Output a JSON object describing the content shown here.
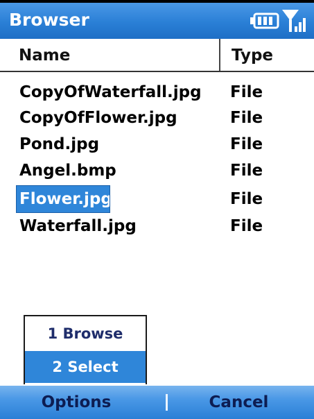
{
  "title_bar": {
    "title": "Browser",
    "battery_icon": "battery-full-icon",
    "signal_icon": "signal-strength-icon"
  },
  "list_header": {
    "name_label": "Name",
    "type_label": "Type"
  },
  "files": [
    {
      "name": "CopyOfWaterfall.jpg",
      "type": "File",
      "selected": false
    },
    {
      "name": "CopyOfFlower.jpg",
      "type": "File",
      "selected": false
    },
    {
      "name": "Pond.jpg",
      "type": "File",
      "selected": false
    },
    {
      "name": "Angel.bmp",
      "type": "File",
      "selected": false
    },
    {
      "name": "Flower.jpg",
      "type": "File",
      "selected": true
    },
    {
      "name": "Waterfall.jpg",
      "type": "File",
      "selected": false
    }
  ],
  "popup_menu": {
    "items": [
      {
        "label": "1 Browse",
        "active": false
      },
      {
        "label": "2 Select",
        "active": true
      }
    ]
  },
  "softkeys": {
    "left": "Options",
    "right": "Cancel"
  },
  "colors": {
    "accent": "#2f86d9",
    "title_bar": "#2a7fd6",
    "menu_text": "#1f2d6b"
  }
}
